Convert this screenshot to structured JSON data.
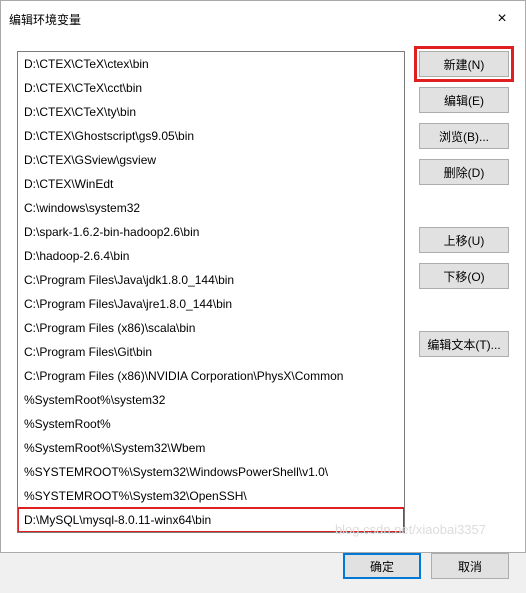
{
  "titlebar": {
    "title": "编辑环境变量",
    "close_icon": "×"
  },
  "list": {
    "items": [
      "D:\\CTEX\\CTeX\\ctex\\bin",
      "D:\\CTEX\\CTeX\\cct\\bin",
      "D:\\CTEX\\CTeX\\ty\\bin",
      "D:\\CTEX\\Ghostscript\\gs9.05\\bin",
      "D:\\CTEX\\GSview\\gsview",
      "D:\\CTEX\\WinEdt",
      "C:\\windows\\system32",
      "D:\\spark-1.6.2-bin-hadoop2.6\\bin",
      "D:\\hadoop-2.6.4\\bin",
      "C:\\Program Files\\Java\\jdk1.8.0_144\\bin",
      "C:\\Program Files\\Java\\jre1.8.0_144\\bin",
      "C:\\Program Files (x86)\\scala\\bin",
      "C:\\Program Files\\Git\\bin",
      "C:\\Program Files (x86)\\NVIDIA Corporation\\PhysX\\Common",
      "%SystemRoot%\\system32",
      "%SystemRoot%",
      "%SystemRoot%\\System32\\Wbem",
      "%SYSTEMROOT%\\System32\\WindowsPowerShell\\v1.0\\",
      "%SYSTEMROOT%\\System32\\OpenSSH\\",
      "D:\\MySQL\\mysql-8.0.11-winx64\\bin"
    ],
    "highlighted_index": 19
  },
  "buttons": {
    "new": "新建(N)",
    "edit": "编辑(E)",
    "browse": "浏览(B)...",
    "delete": "删除(D)",
    "move_up": "上移(U)",
    "move_down": "下移(O)",
    "edit_text": "编辑文本(T)...",
    "highlighted": "new"
  },
  "footer": {
    "ok": "确定",
    "cancel": "取消"
  },
  "watermark": "blog.csdn.net/xiaobai3357"
}
